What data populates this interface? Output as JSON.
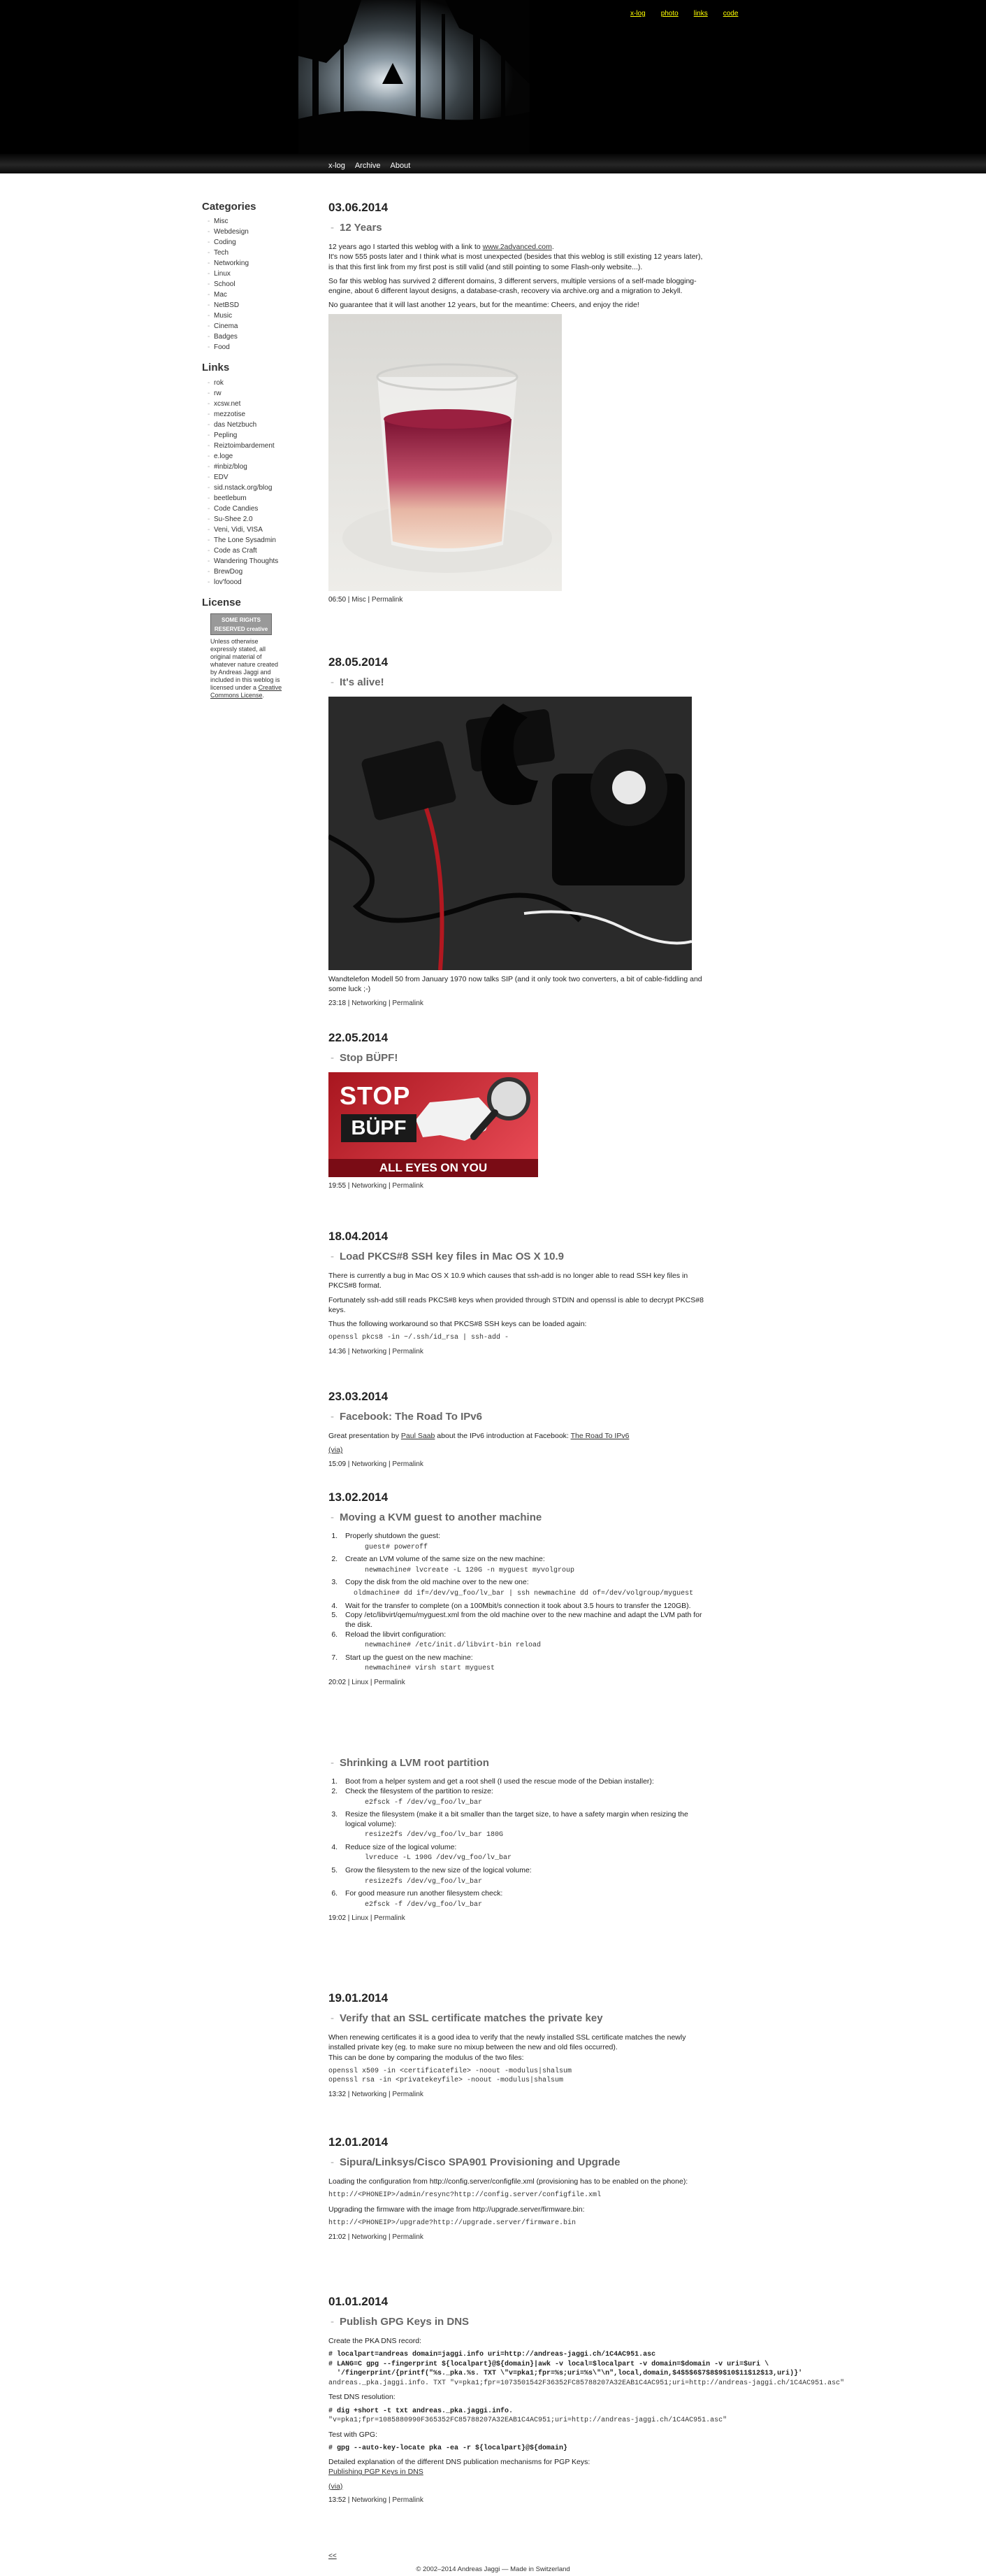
{
  "header": {
    "toplinks": [
      "x-log",
      "photo",
      "links",
      "code"
    ],
    "nav": [
      "x-log",
      "Archive",
      "About"
    ]
  },
  "sidebar": {
    "categories_title": "Categories",
    "categories": [
      "Misc",
      "Webdesign",
      "Coding",
      "Tech",
      "Networking",
      "Linux",
      "School",
      "Mac",
      "NetBSD",
      "Music",
      "Cinema",
      "Badges",
      "Food"
    ],
    "links_title": "Links",
    "links": [
      "rok",
      "rw",
      "xcsw.net",
      "mezzotise",
      "das Netzbuch",
      "Pepling",
      "Reiztoimbardement",
      "e.loge",
      "#inbiz/blog",
      "EDV",
      "sid.nstack.org/blog",
      "beetlebum",
      "Code Candies",
      "Su-Shee 2.0",
      "Veni, Vidi, VISA",
      "The Lone Sysadmin",
      "Code as Craft",
      "Wandering Thoughts",
      "BrewDog",
      "lov'foood"
    ],
    "license_title": "License",
    "license_badge": "SOME RIGHTS RESERVED creative commons",
    "license_text_1": "Unless otherwise expressly stated, all original material of whatever nature created by Andreas Jaggi and included in this weblog is licensed under a",
    "license_link": "Creative Commons License",
    "license_text_2": "."
  },
  "posts": {
    "p1": {
      "date": "03.06.2014",
      "title": "12 Years",
      "para1_a": "12 years ago I started this weblog with a link to",
      "para1_link": "www.2advanced.com",
      "para1_b": ".",
      "para2": "It's now 555 posts later and I think what is most unexpected (besides that this weblog is still existing 12 years later), is that this first link from my first post is still valid (and still pointing to some Flash-only website...).",
      "para3": "So far this weblog has survived 2 different domains, 3 different servers, multiple versions of a self-made blogging-engine, about 6 different layout designs, a database-crash, recovery via archive.org and a migration to Jekyll.",
      "para4": "No guarantee that it will last another 12 years, but for the meantime: Cheers, and enjoy the ride!",
      "time": "06:50",
      "category": "Misc",
      "permalink": "Permalink"
    },
    "p2": {
      "date": "28.05.2014",
      "title": "It's alive!",
      "para1": "Wandtelefon Modell 50 from January 1970 now talks SIP (and it only took two converters, a bit of cable-fiddling and some luck ;-)",
      "time": "23:18",
      "category": "Networking",
      "permalink": "Permalink"
    },
    "p3": {
      "date": "22.05.2014",
      "title": "Stop BÜPF!",
      "banner_stop": "STOP",
      "banner_bupf": "BÜPF",
      "banner_bottom": "ALL EYES ON YOU",
      "time": "19:55",
      "category": "Networking",
      "permalink": "Permalink"
    },
    "p4": {
      "date": "18.04.2014",
      "title": "Load PKCS#8 SSH key files in Mac OS X 10.9",
      "para1": "There is currently a bug in Mac OS X 10.9 which causes that ssh-add is no longer able to read SSH key files in PKCS#8 format.",
      "para2": "Fortunately ssh-add still reads PKCS#8 keys when provided through STDIN and openssl is able to decrypt PKCS#8 keys.",
      "para3": "Thus the following workaround so that PKCS#8 SSH keys can be loaded again:",
      "code": "openssl pkcs8 -in ~/.ssh/id_rsa | ssh-add -",
      "time": "14:36",
      "category": "Networking",
      "permalink": "Permalink"
    },
    "p5": {
      "date": "23.03.2014",
      "title": "Facebook: The Road To IPv6",
      "para_a": "Great presentation by",
      "author_link": "Paul Saab",
      "para_b": "about the IPv6 introduction at Facebook:",
      "talk_link": "The Road To IPv6",
      "via": "(via)",
      "time": "15:09",
      "category": "Networking",
      "permalink": "Permalink"
    },
    "p6": {
      "date": "13.02.2014",
      "title": "Moving a KVM guest to another machine",
      "s1": "Properly shutdown the guest:",
      "c1": "guest# poweroff",
      "s2": "Create an LVM volume of the same size on the new machine:",
      "c2": "newmachine# lvcreate -L 120G -n myguest myvolgroup",
      "s3": "Copy the disk from the old machine over to the new one:",
      "c3": "oldmachine# dd if=/dev/vg_foo/lv_bar | ssh newmachine dd of=/dev/volgroup/myguest",
      "s4": "Wait for the transfer to complete (on a 100Mbit/s connection it took about 3.5 hours to transfer the 120GB).",
      "s5": "Copy /etc/libvirt/qemu/myguest.xml from the old machine over to the new machine and adapt the LVM path for the disk.",
      "s6": "Reload the libvirt configuration:",
      "c6": "newmachine# /etc/init.d/libvirt-bin reload",
      "s7": "Start up the guest on the new machine:",
      "c7": "newmachine# virsh start myguest",
      "time": "20:02",
      "category": "Linux",
      "permalink": "Permalink"
    },
    "p7": {
      "title": "Shrinking a LVM root partition",
      "s1": "Boot from a helper system and get a root shell (I used the rescue mode of the Debian installer):",
      "s2": "Check the filesystem of the partition to resize:",
      "c2": "e2fsck -f /dev/vg_foo/lv_bar",
      "s3": "Resize the filesystem (make it a bit smaller than the target size, to have a safety margin when resizing the logical volume):",
      "c3": "resize2fs /dev/vg_foo/lv_bar 180G",
      "s4": "Reduce size of the logical volume:",
      "c4": "lvreduce -L 190G /dev/vg_foo/lv_bar",
      "s5": "Grow the filesystem to the new size of the logical volume:",
      "c5": "resize2fs /dev/vg_foo/lv_bar",
      "s6": "For good measure run another filesystem check:",
      "c6": "e2fsck -f /dev/vg_foo/lv_bar",
      "time": "19:02",
      "category": "Linux",
      "permalink": "Permalink"
    },
    "p8": {
      "date": "19.01.2014",
      "title": "Verify that an SSL certificate matches the private key",
      "para1": "When renewing certificates it is a good idea to verify that the newly installed SSL certificate matches the newly installed private key (eg. to make sure no mixup between the new and old files occurred).",
      "para2": "This can be done by comparing the modulus of the two files:",
      "c1": "openssl x509 -in <certificatefile> -noout -modulus|shalsum",
      "c2": "openssl rsa -in <privatekeyfile> -noout -modulus|shalsum",
      "time": "13:32",
      "category": "Networking",
      "permalink": "Permalink"
    },
    "p9": {
      "date": "12.01.2014",
      "title": "Sipura/Linksys/Cisco SPA901 Provisioning and Upgrade",
      "para1": "Loading the configuration from http://config.server/configfile.xml (provisioning has to be enabled on the phone):",
      "c1": "http://<PHONEIP>/admin/resync?http://config.server/configfile.xml",
      "para2": "Upgrading the firmware with the image from http://upgrade.server/firmware.bin:",
      "c2": "http://<PHONEIP>/upgrade?http://upgrade.server/firmware.bin",
      "time": "21:02",
      "category": "Networking",
      "permalink": "Permalink"
    },
    "p10": {
      "date": "01.01.2014",
      "title": "Publish GPG Keys in DNS",
      "para1": "Create the PKA DNS record:",
      "c1a": "# localpart=andreas domain=jaggi.info uri=http://andreas-jaggi.ch/1C4AC951.asc",
      "c1b": "# LANG=C gpg --fingerprint ${localpart}@${domain}|awk -v local=$localpart -v domain=$domain -v uri=$uri \\",
      "c1c": "  '/fingerprint/{printf(\"%s._pka.%s. TXT \\\"v=pka1;fpr=%s;uri=%s\\\"\\n\",local,domain,$4$5$6$7$8$9$10$11$12$13,uri)}'",
      "c1d": "andreas._pka.jaggi.info. TXT \"v=pka1;fpr=1073501542F36352FC85788207A32EAB1C4AC951;uri=http://andreas-jaggi.ch/1C4AC951.asc\"",
      "para2": "Test DNS resolution:",
      "c2a": "# dig +short -t txt andreas._pka.jaggi.info.",
      "c2b": "\"v=pka1;fpr=1085880990F365352FC85788207A32EAB1C4AC951;uri=http://andreas-jaggi.ch/1C4AC951.asc\"",
      "para3": "Test with GPG:",
      "c3": "# gpg --auto-key-locate pka -ea -r ${localpart}@${domain}",
      "para4": "Detailed explanation of the different DNS publication mechanisms for PGP Keys:",
      "link": "Publishing PGP Keys in DNS",
      "via": "(via)",
      "time": "13:52",
      "category": "Networking",
      "permalink": "Permalink"
    }
  },
  "footer": {
    "older": "<<",
    "copyright": "© 2002–2014 Andreas Jaggi — Made in Switzerland"
  }
}
